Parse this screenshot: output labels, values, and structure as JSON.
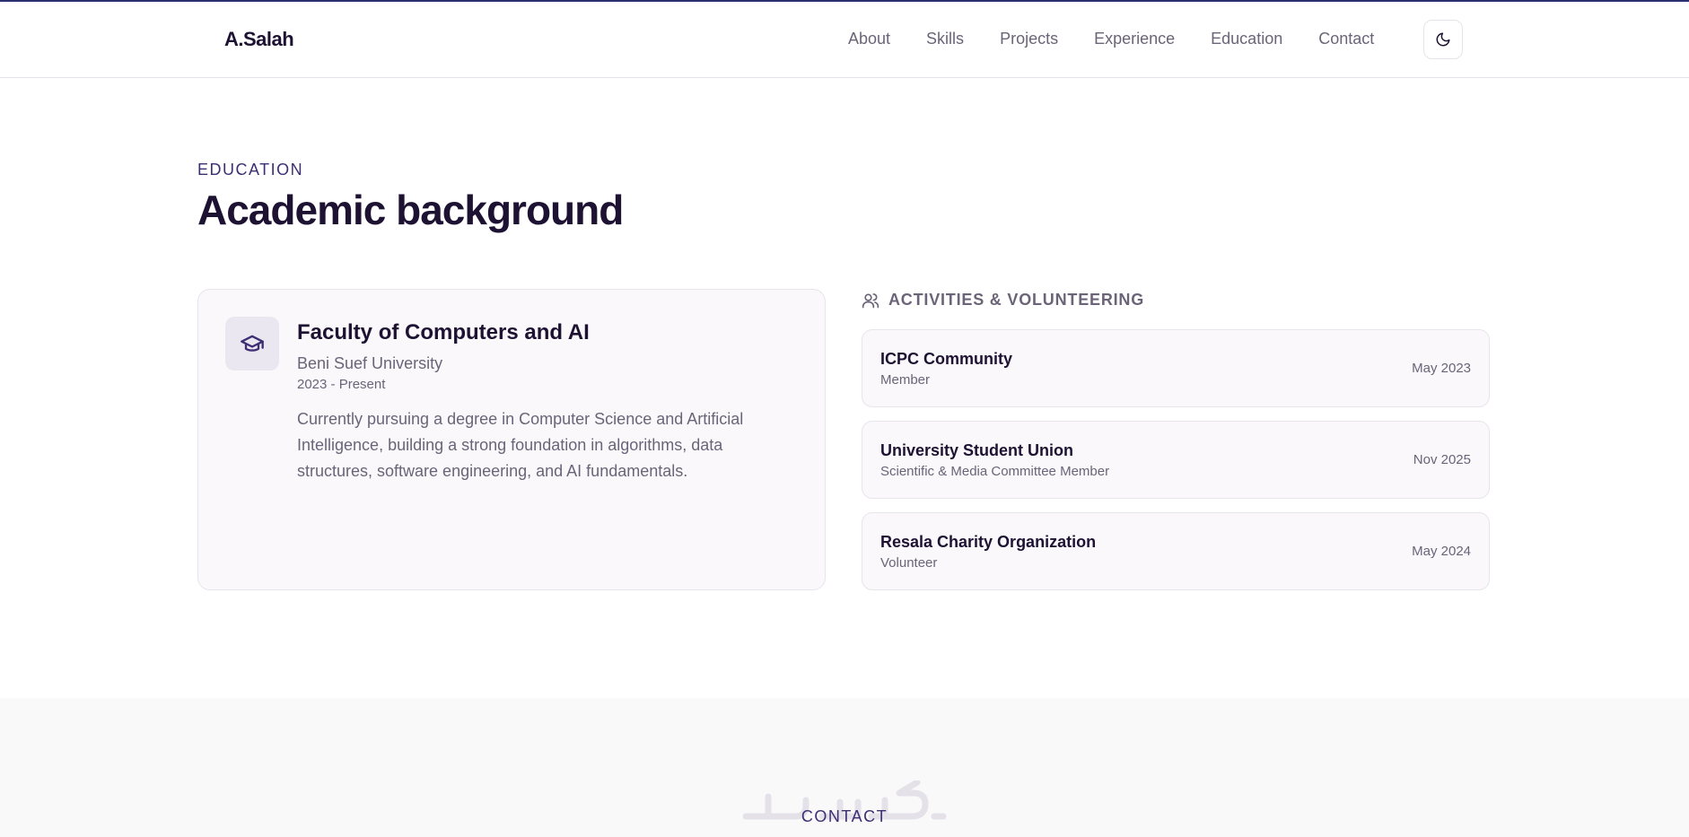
{
  "header": {
    "logo": "A.Salah",
    "nav": [
      {
        "label": "About"
      },
      {
        "label": "Skills"
      },
      {
        "label": "Projects"
      },
      {
        "label": "Experience"
      },
      {
        "label": "Education"
      },
      {
        "label": "Contact"
      }
    ],
    "theme_toggle_icon": "moon-icon"
  },
  "section": {
    "eyebrow": "EDUCATION",
    "title": "Academic background"
  },
  "education": {
    "icon": "graduation-cap-icon",
    "title": "Faculty of Computers and AI",
    "school": "Beni Suef University",
    "period": "2023 - Present",
    "description": "Currently pursuing a degree in Computer Science and Artificial Intelligence, building a strong foundation in algorithms, data structures, software engineering, and AI fundamentals."
  },
  "activities": {
    "icon": "users-icon",
    "heading": "ACTIVITIES & VOLUNTEERING",
    "items": [
      {
        "name": "ICPC Community",
        "role": "Member",
        "date": "May 2023"
      },
      {
        "name": "University Student Union",
        "role": "Scientific & Media Committee Member",
        "date": "Nov 2025"
      },
      {
        "name": "Resala Charity Organization",
        "role": "Volunteer",
        "date": "May 2024"
      }
    ]
  },
  "contact": {
    "eyebrow": "CONTACT",
    "watermark_icon": "khamsat-watermark-logo"
  },
  "colors": {
    "accent": "#3e2f74",
    "text": "#1e1233",
    "muted": "#6b6478",
    "card": "#faf8fb",
    "border": "#e8e4ec"
  }
}
